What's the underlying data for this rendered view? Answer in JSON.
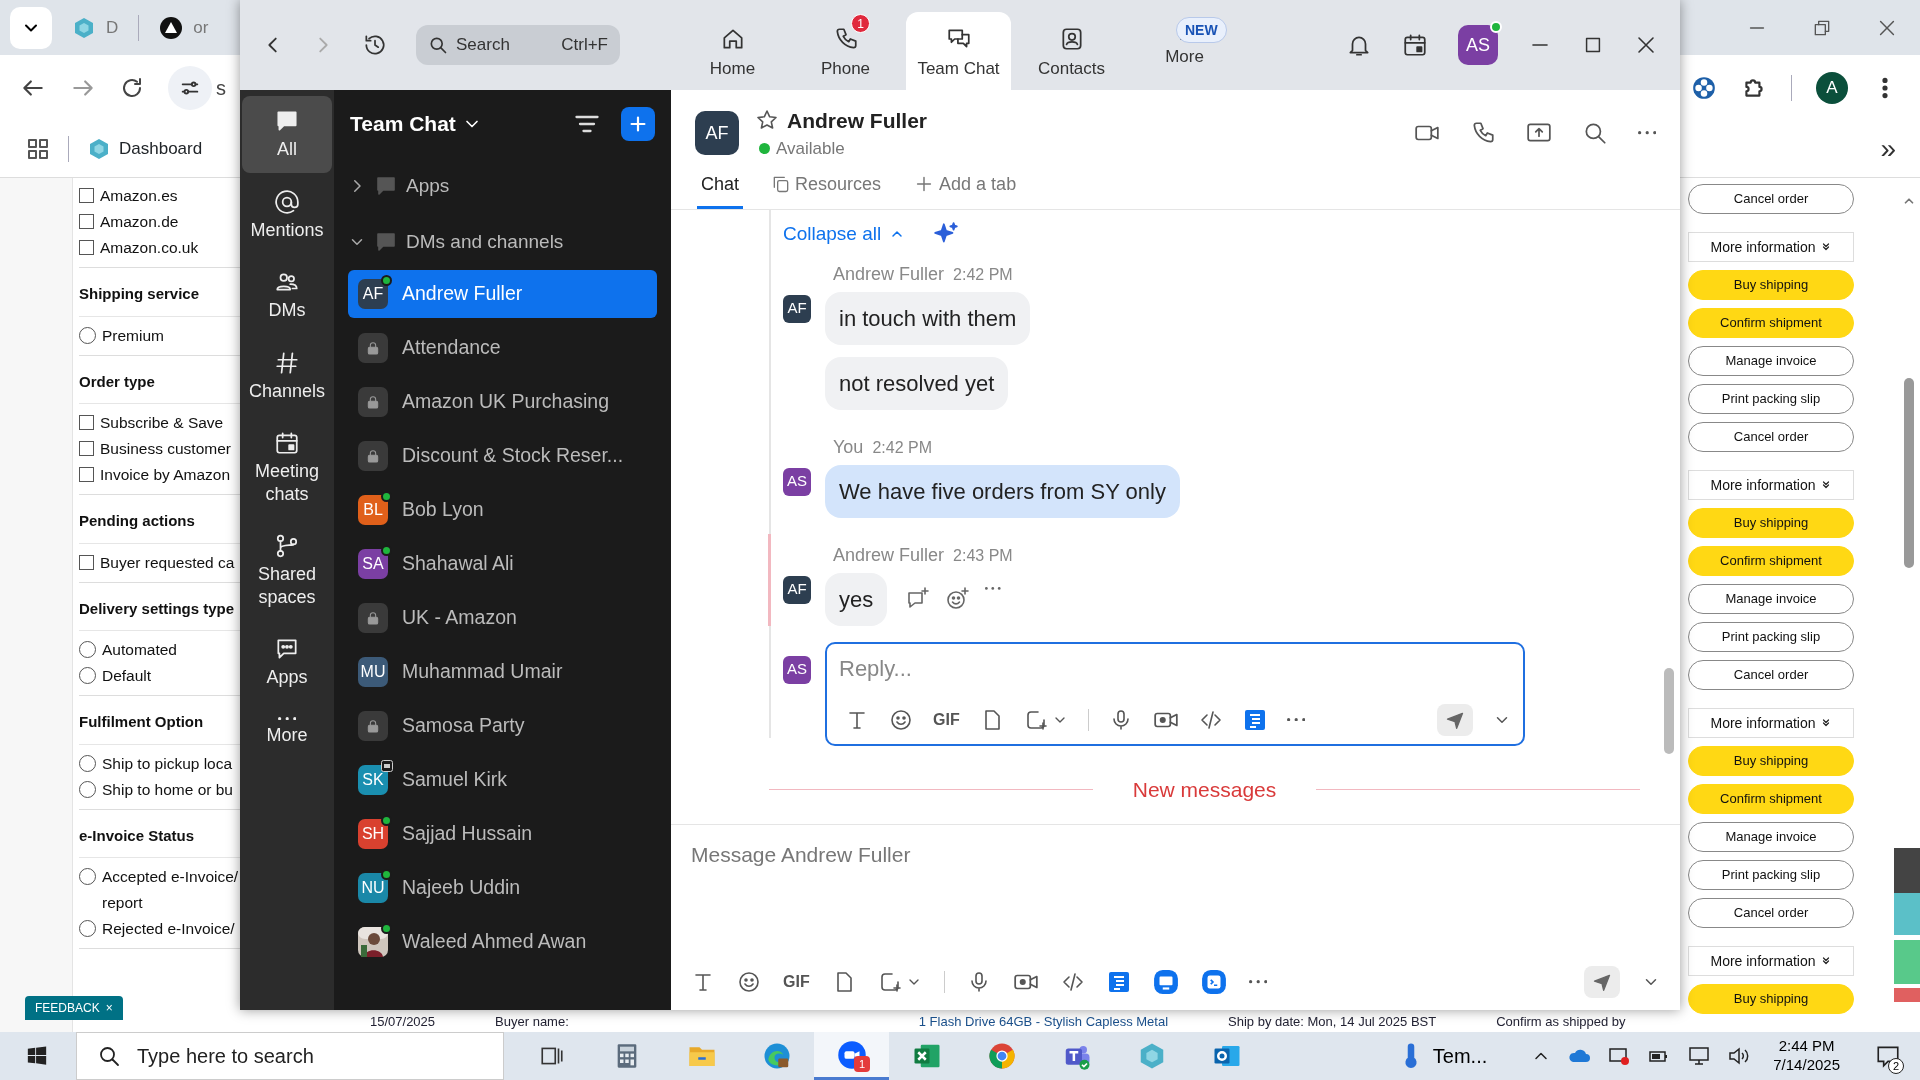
{
  "browser": {
    "tabs": [
      {
        "label": "D",
        "kind": "hex"
      },
      {
        "label": "or",
        "kind": "dark"
      }
    ],
    "address": "s",
    "bookmark": "Dashboard",
    "profile": "A",
    "overflow": "»"
  },
  "filters": [
    {
      "options": [
        {
          "label": "Amazon.es",
          "kind": "checkbox",
          "checked": false
        },
        {
          "label": "Amazon.de",
          "kind": "checkbox",
          "checked": false
        },
        {
          "label": "Amazon.co.uk",
          "kind": "checkbox",
          "checked": false
        }
      ]
    },
    {
      "title": "Shipping service",
      "options": [
        {
          "label": "Premium",
          "kind": "radio",
          "checked": false
        }
      ]
    },
    {
      "title": "Order type",
      "options": [
        {
          "label": "Subscribe & Save",
          "kind": "checkbox",
          "checked": false
        },
        {
          "label": "Business customer",
          "kind": "checkbox",
          "checked": false
        },
        {
          "label": "Invoice by Amazon",
          "kind": "checkbox",
          "checked": false
        }
      ]
    },
    {
      "title": "Pending actions",
      "options": [
        {
          "label": "Buyer requested ca",
          "kind": "checkbox",
          "checked": false
        }
      ]
    },
    {
      "title": "Delivery settings type",
      "options": [
        {
          "label": "Automated",
          "kind": "radio",
          "checked": false
        },
        {
          "label": "Default",
          "kind": "radio",
          "checked": false
        }
      ]
    },
    {
      "title": "Fulfilment Option",
      "options": [
        {
          "label": "Ship to pickup loca",
          "kind": "radio",
          "checked": false
        },
        {
          "label": "Ship to home or bu",
          "kind": "radio",
          "checked": false
        }
      ]
    },
    {
      "title": "e-Invoice Status",
      "options": [
        {
          "label": "Accepted e-Invoice/ report",
          "kind": "radio",
          "checked": false
        },
        {
          "label": "Rejected e-Invoice/",
          "kind": "radio",
          "checked": false
        }
      ]
    }
  ],
  "feedback": {
    "label": "FEEDBACK",
    "close": "×"
  },
  "order_actions": [
    {
      "label": "Cancel order",
      "kind": "outline"
    },
    {
      "label": "More information",
      "kind": "info"
    },
    {
      "label": "Buy shipping",
      "kind": "primary"
    },
    {
      "label": "Confirm shipment",
      "kind": "primary"
    },
    {
      "label": "Manage invoice",
      "kind": "outline"
    },
    {
      "label": "Print packing slip",
      "kind": "outline"
    },
    {
      "label": "Cancel order",
      "kind": "outline"
    },
    {
      "label": "More information",
      "kind": "info"
    },
    {
      "label": "Buy shipping",
      "kind": "primary"
    },
    {
      "label": "Confirm shipment",
      "kind": "primary"
    },
    {
      "label": "Manage invoice",
      "kind": "outline"
    },
    {
      "label": "Print packing slip",
      "kind": "outline"
    },
    {
      "label": "Cancel order",
      "kind": "outline"
    },
    {
      "label": "More information",
      "kind": "info"
    },
    {
      "label": "Buy shipping",
      "kind": "primary"
    },
    {
      "label": "Confirm shipment",
      "kind": "primary"
    },
    {
      "label": "Manage invoice",
      "kind": "outline"
    },
    {
      "label": "Print packing slip",
      "kind": "outline"
    },
    {
      "label": "Cancel order",
      "kind": "outline"
    },
    {
      "label": "More information",
      "kind": "info"
    },
    {
      "label": "Buy shipping",
      "kind": "primary"
    }
  ],
  "footer_texts": [
    "15/07/2025",
    "Buyer name:",
    "1 Flash Drive 64GB - Stylish Capless Metal",
    "Ship by date: Mon, 14 Jul 2025 BST",
    "Confirm as shipped by"
  ],
  "zoom": {
    "search": {
      "label": "Search",
      "shortcut": "Ctrl+F"
    },
    "tabs": [
      {
        "label": "Home",
        "kind": "home",
        "selected": false
      },
      {
        "label": "Phone",
        "kind": "phone",
        "selected": false,
        "badge": "1"
      },
      {
        "label": "Team Chat",
        "kind": "chat",
        "selected": true
      },
      {
        "label": "Contacts",
        "kind": "contacts",
        "selected": false
      },
      {
        "label": "More",
        "kind": "more",
        "selected": false,
        "badge": "NEW"
      }
    ],
    "user": {
      "initials": "AS",
      "color": "#7b3fa3",
      "online": true
    },
    "rail": [
      {
        "label": "All",
        "kind": "all",
        "selected": true
      },
      {
        "label": "Mentions",
        "kind": "mentions",
        "selected": false
      },
      {
        "label": "DMs",
        "kind": "dms",
        "selected": false
      },
      {
        "label": "Channels",
        "kind": "channels",
        "selected": false
      },
      {
        "label": "Meeting chats",
        "kind": "meetings",
        "selected": false
      },
      {
        "label": "Shared spaces",
        "kind": "shared",
        "selected": false
      },
      {
        "label": "Apps",
        "kind": "apps",
        "selected": false
      },
      {
        "label": "More",
        "kind": "more",
        "selected": false
      }
    ],
    "sidebar": {
      "title": "Team Chat",
      "sections": [
        {
          "label": "Apps",
          "expanded": false
        },
        {
          "label": "DMs and channels",
          "expanded": true,
          "items": [
            {
              "label": "Andrew Fuller",
              "kind": "dm",
              "initials": "AF",
              "color": "#2d3e50",
              "online": true,
              "selected": true
            },
            {
              "label": "Attendance",
              "kind": "channel",
              "selected": false
            },
            {
              "label": "Amazon UK Purchasing",
              "kind": "channel",
              "selected": false
            },
            {
              "label": "Discount & Stock Reser...",
              "kind": "channel",
              "selected": false
            },
            {
              "label": "Bob Lyon",
              "kind": "dm",
              "initials": "BL",
              "color": "#e0601a",
              "online": true,
              "selected": false
            },
            {
              "label": "Shahawal Ali",
              "kind": "dm",
              "initials": "SA",
              "color": "#7b3fa3",
              "online": true,
              "selected": false
            },
            {
              "label": "UK - Amazon",
              "kind": "channel",
              "selected": false
            },
            {
              "label": "Muhammad Umair",
              "kind": "dm",
              "initials": "MU",
              "color": "#3c5a78",
              "online": false,
              "selected": false
            },
            {
              "label": "Samosa Party",
              "kind": "channel",
              "selected": false
            },
            {
              "label": "Samuel Kirk",
              "kind": "dm",
              "initials": "SK",
              "color": "#1a8fb0",
              "online": false,
              "in_meeting": true,
              "selected": false
            },
            {
              "label": "Sajjad Hussain",
              "kind": "dm",
              "initials": "SH",
              "color": "#d9412f",
              "online": true,
              "selected": false
            },
            {
              "label": "Najeeb Uddin",
              "kind": "dm",
              "initials": "NU",
              "color": "#1a88a8",
              "online": true,
              "selected": false
            },
            {
              "label": "Waleed Ahmed Awan",
              "online": true,
              "selected": false
            }
          ]
        }
      ]
    },
    "chat": {
      "name": "Andrew Fuller",
      "initials": "AF",
      "color": "#2d3e50",
      "status": "Available",
      "online": true,
      "tabs": [
        {
          "label": "Chat",
          "selected": true
        },
        {
          "label": "Resources",
          "selected": false,
          "kind": "resources"
        },
        {
          "label": "Add a tab",
          "selected": false,
          "kind": "add"
        }
      ],
      "collapse": "Collapse all",
      "groups": [
        {
          "author": "Andrew Fuller",
          "time": "2:42 PM",
          "initials": "AF",
          "color": "#2d3e50",
          "mine": false,
          "hovered": false,
          "bubbles": [
            "in touch with them",
            "not resolved yet"
          ]
        },
        {
          "author": "You",
          "time": "2:42 PM",
          "initials": "AS",
          "color": "#7b3fa3",
          "mine": true,
          "hovered": false,
          "bubbles": [
            "We have five orders from SY only"
          ]
        },
        {
          "author": "Andrew Fuller",
          "time": "2:43 PM",
          "initials": "AF",
          "color": "#2d3e50",
          "mine": false,
          "hovered": true,
          "bubbles": [
            "yes"
          ]
        }
      ],
      "reply": {
        "initials": "AS",
        "color": "#7b3fa3",
        "placeholder": "Reply...",
        "gif": "GIF"
      },
      "new_messages": "New messages",
      "composer": {
        "placeholder": "Message Andrew Fuller",
        "gif": "GIF"
      }
    }
  },
  "taskbar": {
    "search": "Type here to search",
    "apps": [
      {
        "kind": "taskview",
        "active": false
      },
      {
        "kind": "calculator",
        "active": false
      },
      {
        "kind": "explorer",
        "active": false
      },
      {
        "kind": "edge",
        "active": false
      },
      {
        "kind": "zoom",
        "active": true,
        "badge": "1"
      },
      {
        "kind": "excel",
        "active": false
      },
      {
        "kind": "chrome",
        "active": false
      },
      {
        "kind": "teams",
        "active": false
      },
      {
        "kind": "hexapp",
        "active": false
      },
      {
        "kind": "outlook",
        "active": false
      }
    ],
    "weather": "Tem...",
    "time": "2:44 PM",
    "date": "7/14/2025",
    "notifications": "2"
  }
}
